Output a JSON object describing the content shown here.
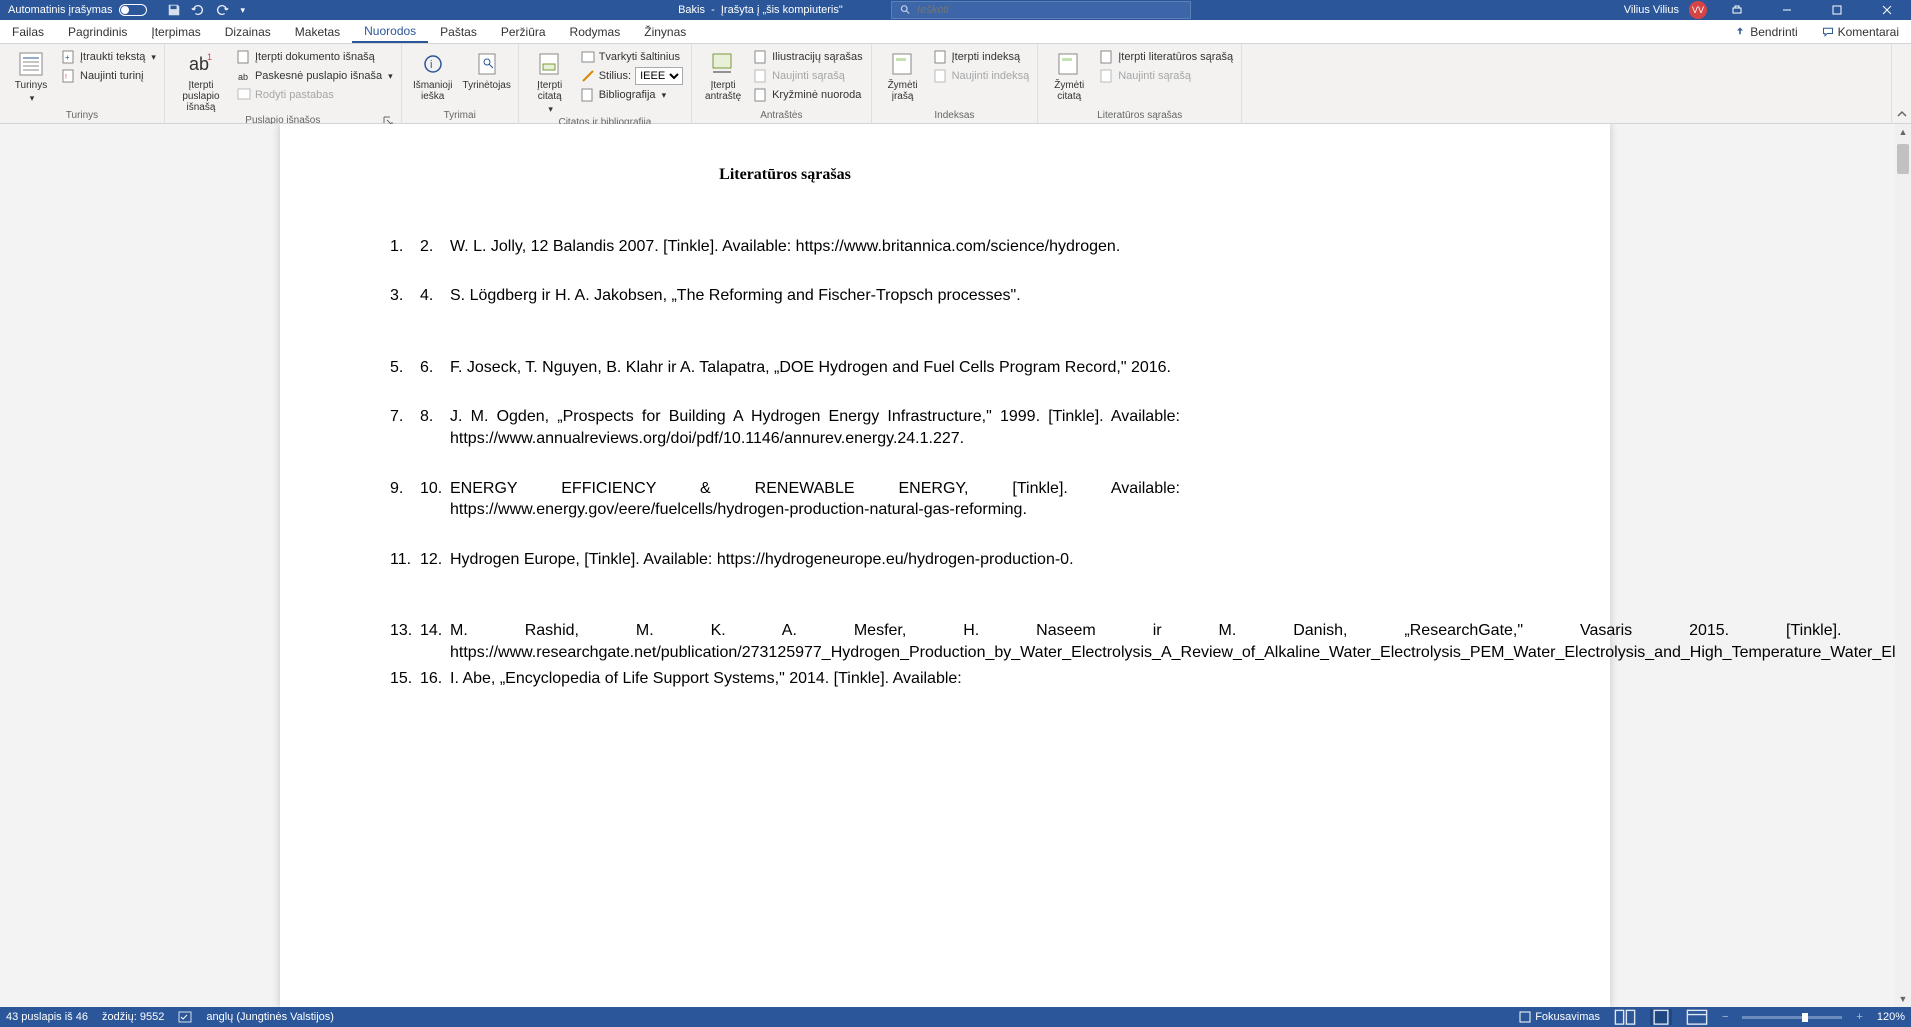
{
  "titlebar": {
    "autosave_label": "Automatinis įrašymas",
    "doc_name": "Bakis",
    "doc_status": "Įrašyta į „šis kompiuteris\"",
    "search_placeholder": "Ieškoti",
    "user_name": "Vilius Vilius",
    "user_initials": "VV"
  },
  "tabs": {
    "items": [
      "Failas",
      "Pagrindinis",
      "Įterpimas",
      "Dizainas",
      "Maketas",
      "Nuorodos",
      "Paštas",
      "Peržiūra",
      "Rodymas",
      "Žinynas"
    ],
    "active_index": 5,
    "share": "Bendrinti",
    "comments": "Komentarai"
  },
  "ribbon": {
    "g0": {
      "label": "Turinys",
      "toc": "Turinys",
      "add_text": "Įtraukti tekstą",
      "update_toc": "Naujinti turinį"
    },
    "g1": {
      "label": "Puslapio išnašos",
      "insert_fn": "Įterpti puslapio išnašą",
      "insert_en": "Įterpti dokumento išnašą",
      "next_fn": "Paskesnė puslapio išnaša",
      "show_notes": "Rodyti pastabas"
    },
    "g2": {
      "label": "Tyrimai",
      "smart_lookup": "Išmanioji ieška",
      "researcher": "Tyrinėtojas"
    },
    "g3": {
      "label": "Citatos ir bibliografija",
      "insert_citation": "Įterpti citatą",
      "manage": "Tvarkyti šaltinius",
      "style_label": "Stilius:",
      "style_value": "IEEE",
      "biblio": "Bibliografija"
    },
    "g4": {
      "label": "Antraštės",
      "insert_caption": "Įterpti antraštę",
      "figures": "Iliustracijų sąrašas",
      "update_table": "Naujinti sąrašą",
      "crossref": "Kryžminė nuoroda"
    },
    "g5": {
      "label": "Indeksas",
      "mark_entry": "Žymėti įrašą",
      "insert_index": "Įterpti indeksą",
      "update_index": "Naujinti indeksą"
    },
    "g6": {
      "label": "Literatūros sąrašas",
      "mark_citation": "Žymėti citatą",
      "insert_toa": "Įterpti literatūros sąrašą",
      "update_toa": "Naujinti sąrašą"
    }
  },
  "document": {
    "heading": "Literatūros sąrašas",
    "refs": [
      {
        "n1": "1.",
        "n2": "2.",
        "text": "W. L. Jolly, 12 Balandis 2007. [Tinkle]. Available: https://www.britannica.com/science/hydrogen."
      },
      {
        "n1": "3.",
        "n2": "4.",
        "text": "S. Lögdberg ir H. A. Jakobsen, „The Reforming and Fischer-Tropsch processes\"."
      },
      {
        "n1": "5.",
        "n2": "6.",
        "text": "F. Joseck, T. Nguyen, B. Klahr ir A. Talapatra, „DOE Hydrogen and Fuel Cells Program Record,\" 2016."
      },
      {
        "n1": "7.",
        "n2": "8.",
        "text": "J. M. Ogden, „Prospects for Building A Hydrogen Energy Infrastructure,\" 1999. [Tinkle]. Available: https://www.annualreviews.org/doi/pdf/10.1146/annurev.energy.24.1.227."
      },
      {
        "n1": "9.",
        "n2": "10.",
        "text": "ENERGY EFFICIENCY & RENEWABLE ENERGY, [Tinkle]. Available: https://www.energy.gov/eere/fuelcells/hydrogen-production-natural-gas-reforming."
      },
      {
        "n1": "11.",
        "n2": "12.",
        "text": "Hydrogen Europe, [Tinkle]. Available: https://hydrogeneurope.eu/hydrogen-production-0."
      },
      {
        "n1": "13.",
        "n2": "14.",
        "text": "M. Rashid, M. K. A. Mesfer, H. Naseem ir M. Danish, „ResearchGate,\" Vasaris 2015. [Tinkle]. Available: https://www.researchgate.net/publication/273125977_Hydrogen_Production_by_Water_Electrolysis_A_Review_of_Alkaline_Water_Electrolysis_PEM_Water_Electrolysis_and_High_Temperature_Water_Electrolysis."
      },
      {
        "n1": "15.",
        "n2": "16.",
        "text": "I. Abe, „Encyclopedia of Life Support Systems,\" 2014. [Tinkle]. Available:"
      }
    ]
  },
  "status": {
    "page_info": "43 puslapis iš 46",
    "word_count": "žodžių: 9552",
    "language": "anglų (Jungtinės Valstijos)",
    "focus": "Fokusavimas",
    "zoom": "120%"
  }
}
